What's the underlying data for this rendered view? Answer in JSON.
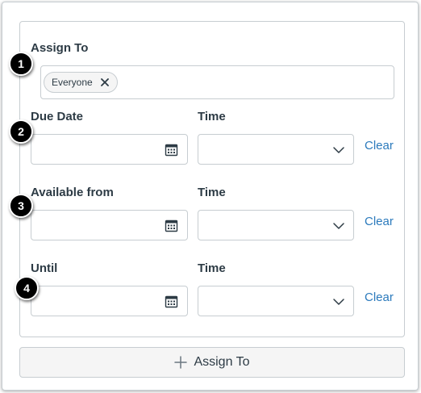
{
  "assign": {
    "label": "Assign To",
    "tokens": [
      {
        "label": "Everyone",
        "icon": "close-icon"
      }
    ]
  },
  "rows": [
    {
      "date_label": "Due Date",
      "time_label": "Time",
      "clear_label": "Clear",
      "date_value": "",
      "time_value": ""
    },
    {
      "date_label": "Available from",
      "time_label": "Time",
      "clear_label": "Clear",
      "date_value": "",
      "time_value": ""
    },
    {
      "date_label": "Until",
      "time_label": "Time",
      "clear_label": "Clear",
      "date_value": "",
      "time_value": ""
    }
  ],
  "callouts": [
    "1",
    "2",
    "3",
    "4"
  ],
  "add_button": {
    "label": "Assign To",
    "icon": "plus-icon"
  },
  "icons": {
    "date_picker": "calendar-icon",
    "time_dropdown": "chevron-down-icon"
  },
  "colors": {
    "link": "#2b7abc",
    "text": "#2d3b45",
    "border": "#c7cdd1",
    "callout": "#000000"
  }
}
